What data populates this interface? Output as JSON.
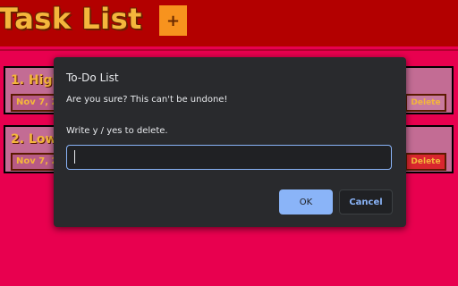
{
  "app": {
    "title": "Task List",
    "add_label": "+"
  },
  "tasks": [
    {
      "title": "1. High",
      "date": "Nov 7, 2",
      "delete_label": "Delete"
    },
    {
      "title": "2. Low",
      "date": "Nov 7, 2",
      "delete_label": "Delete"
    }
  ],
  "dialog": {
    "title": "To-Do List",
    "message": "Are you sure? This can't be undone!",
    "prompt": "Write y / yes to delete.",
    "input_value": "",
    "ok_label": "OK",
    "cancel_label": "Cancel"
  },
  "colors": {
    "page_background": "#e8004f",
    "header_background": "#b30000",
    "title_color": "#f4b63c",
    "add_button": "#f7931e",
    "task_background": "#c36c94",
    "dialog_background": "#292a2d",
    "accent": "#8ab4f8"
  },
  "icons": {
    "add": "plus-icon"
  }
}
